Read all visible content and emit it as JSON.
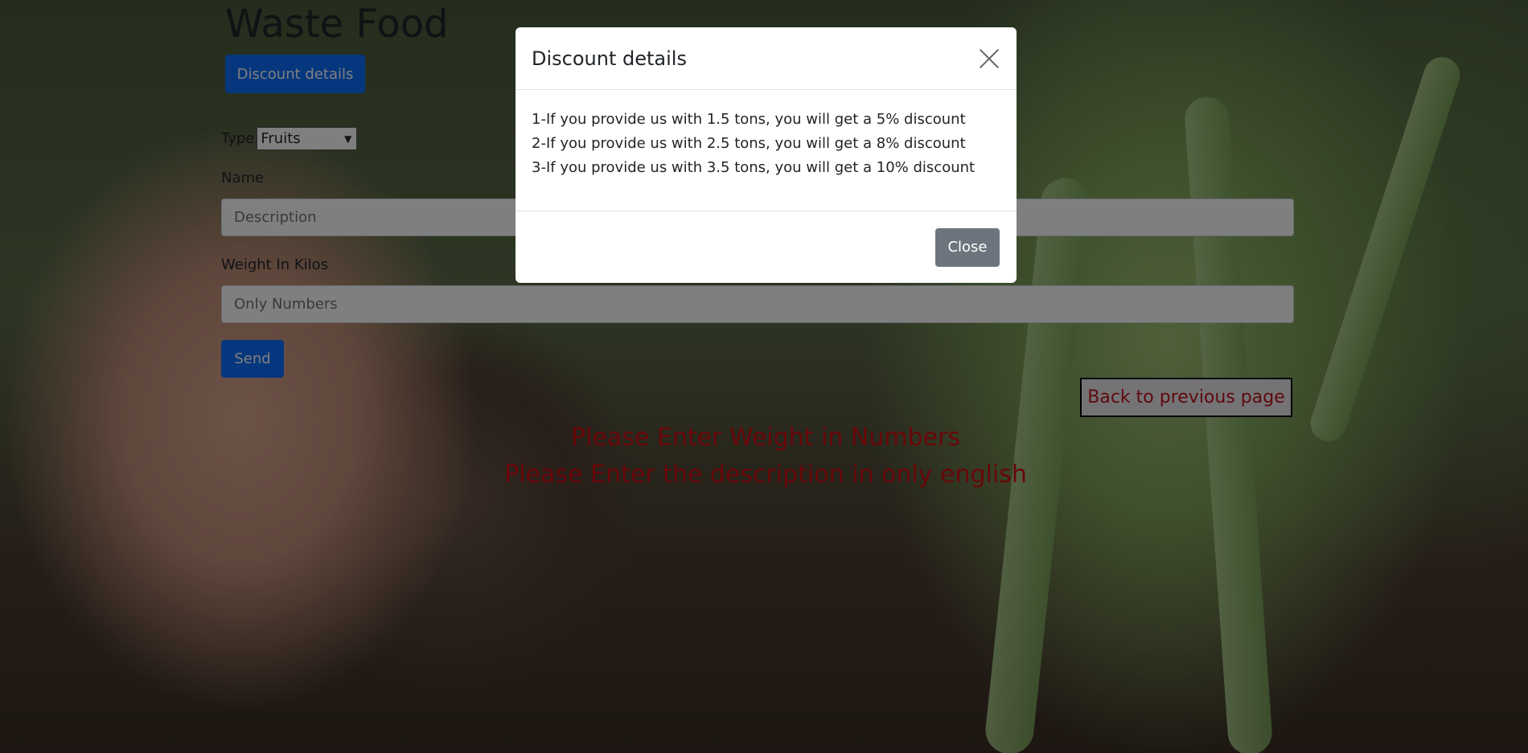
{
  "page": {
    "title": "Waste Food",
    "discount_button": "Discount details",
    "type_label": "Type",
    "type_selected": "Fruits",
    "name_label": "Name",
    "name_placeholder": "Description",
    "weight_label": "Weight In Kilos",
    "weight_placeholder": "Only Numbers",
    "send_button": "Send",
    "back_button": "Back to previous page",
    "errors": [
      "Please Enter Weight in Numbers",
      "Please Enter the description in only english"
    ]
  },
  "modal": {
    "title": "Discount details",
    "lines": [
      "1-If you provide us with 1.5 tons, you will get a 5% discount",
      "2-If you provide us with 2.5 tons, you will get a 8% discount",
      "3-If you provide us with 3.5 tons, you will get a 10% discount"
    ],
    "close_button": "Close",
    "close_icon": "close-icon"
  },
  "colors": {
    "primary": "#0d6efd",
    "secondary": "#6c757d",
    "error": "#d30d12"
  }
}
